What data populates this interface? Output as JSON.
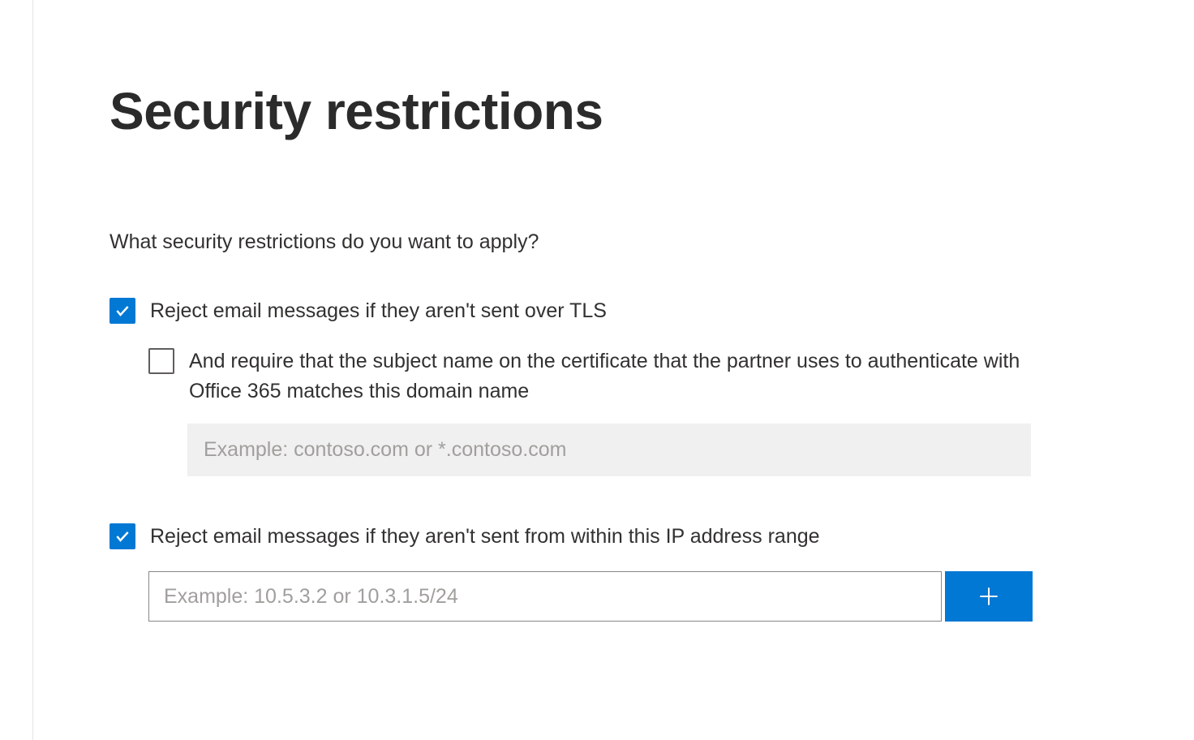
{
  "title": "Security restrictions",
  "prompt": "What security restrictions do you want to apply?",
  "tls": {
    "label": "Reject email messages if they aren't sent over TLS",
    "checked": true,
    "certMatch": {
      "label": "And require that the subject name on the certificate that the partner uses to authenticate with Office 365 matches this domain name",
      "checked": false,
      "placeholder": "Example: contoso.com or *.contoso.com",
      "value": ""
    }
  },
  "ipRange": {
    "label": "Reject email messages if they aren't sent from within this IP address range",
    "checked": true,
    "placeholder": "Example: 10.5.3.2 or 10.3.1.5/24",
    "value": ""
  }
}
